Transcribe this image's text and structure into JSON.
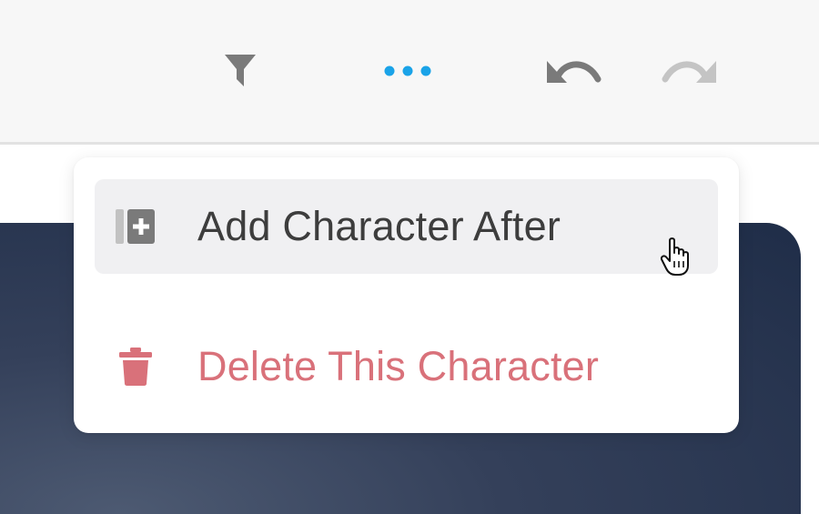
{
  "toolbar": {
    "icons": {
      "filter": "filter-icon",
      "more": "more-horizontal-icon",
      "undo": "undo-icon",
      "redo": "redo-icon"
    }
  },
  "menu": {
    "items": [
      {
        "label": "Add Character After",
        "icon": "add-column-icon"
      },
      {
        "label": "Delete This Character",
        "icon": "trash-icon"
      }
    ]
  },
  "colors": {
    "accent": "#1aa3e8",
    "danger": "#d9717a",
    "icon_gray": "#7a7a7a",
    "icon_disabled": "#c4c4c4",
    "card_bg": "#1f2d48"
  }
}
